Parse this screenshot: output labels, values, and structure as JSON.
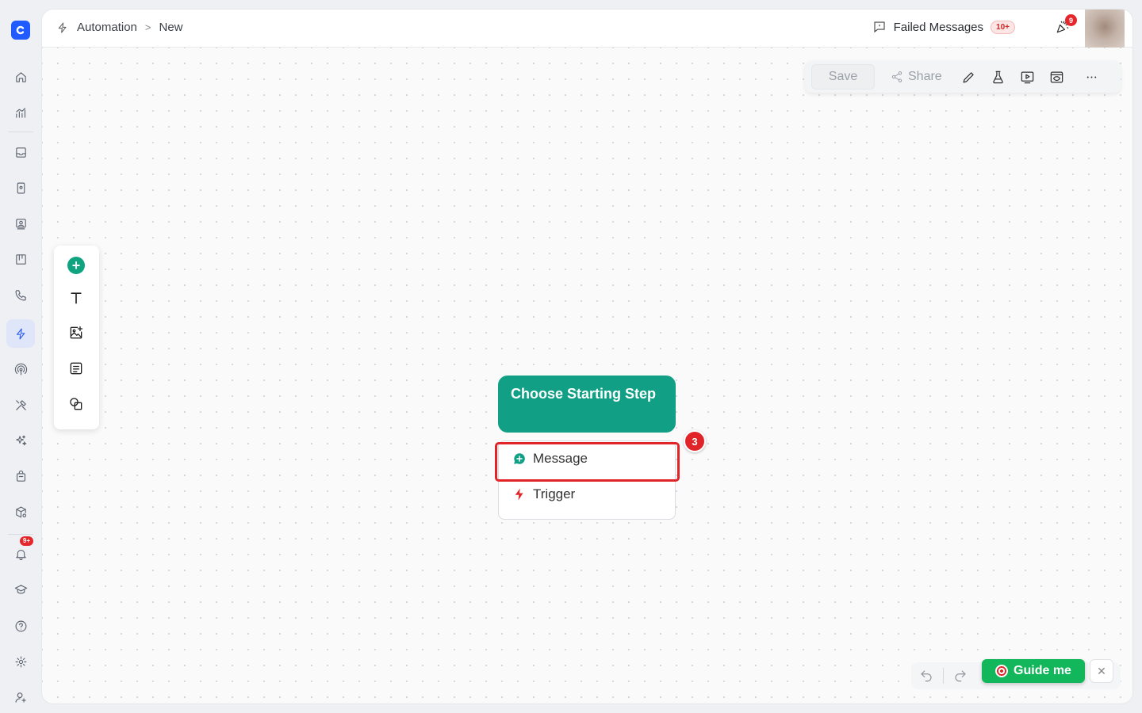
{
  "breadcrumb": {
    "section": "Automation",
    "current": "New"
  },
  "header": {
    "failed_label": "Failed Messages",
    "failed_badge": "10+",
    "notif_badge": "9"
  },
  "sidebar": {
    "notif_badge": "9+"
  },
  "toolbar": {
    "save_label": "Save",
    "share_label": "Share"
  },
  "node": {
    "title": "Choose Starting Step",
    "options": [
      {
        "label": "Message"
      },
      {
        "label": "Trigger"
      }
    ],
    "step_number": "3"
  },
  "guide": {
    "label": "Guide me",
    "close": "✕"
  },
  "colors": {
    "accent": "#11a085",
    "brand": "#1f5bff",
    "highlight": "#e12428",
    "guide": "#11b75a"
  }
}
